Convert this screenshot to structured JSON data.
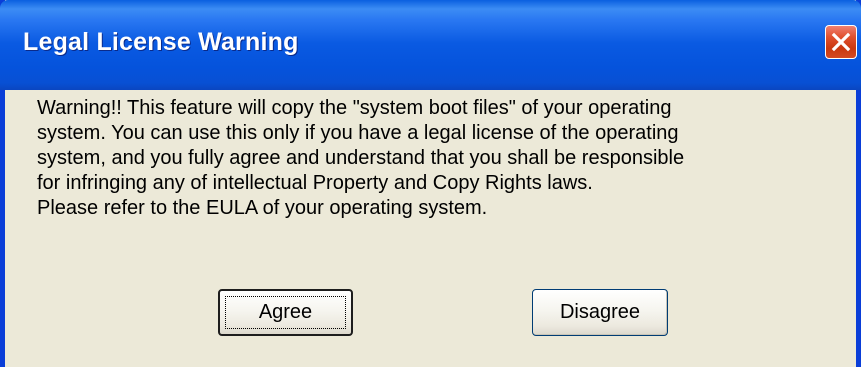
{
  "dialog": {
    "title": "Legal License Warning",
    "close_icon": "close-icon",
    "message_lines": [
      "Warning!! This feature will copy the \"system boot files\" of your operating",
      "system. You can use this only if you have a legal license of the operating",
      "system, and you fully agree and understand that you shall be responsible",
      "for infringing any of intellectual Property and Copy Rights laws.",
      "Please refer to the EULA of your operating system."
    ],
    "agree_label": "Agree",
    "disagree_label": "Disagree"
  },
  "colors": {
    "titlebar": "#0a5ae2",
    "frame": "#0a3ed8",
    "body": "#ece9d8",
    "close_button": "#c93810"
  }
}
